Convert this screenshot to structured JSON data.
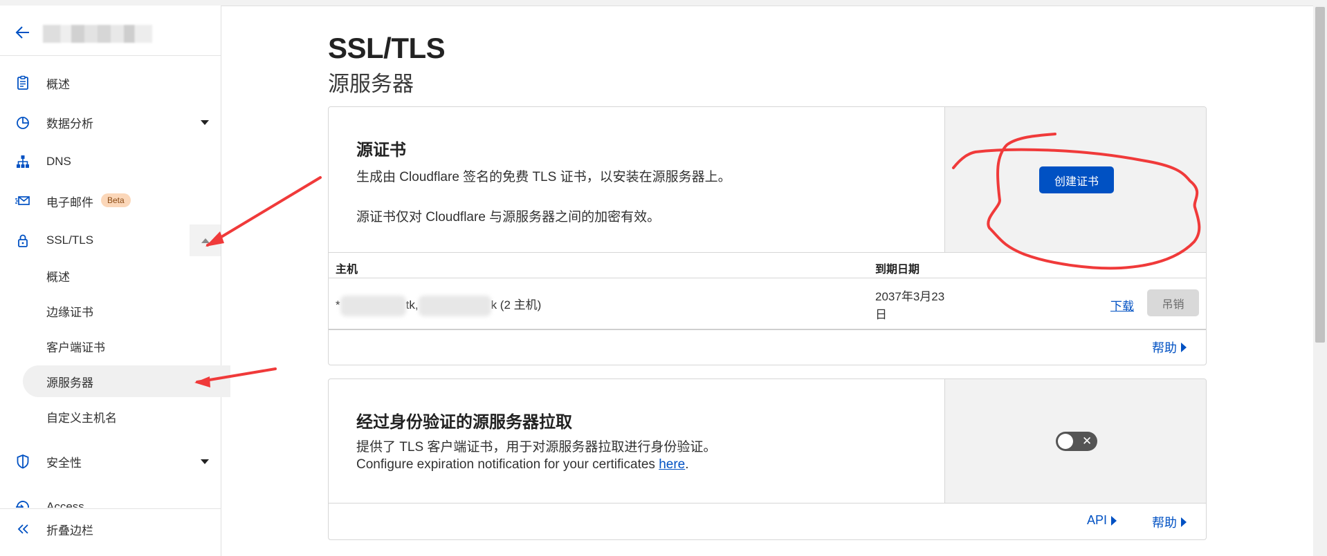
{
  "sidebar": {
    "nav": [
      {
        "label": "概述",
        "icon": "document-icon"
      },
      {
        "label": "数据分析",
        "icon": "pie-chart-icon"
      },
      {
        "label": "DNS",
        "icon": "network-tree-icon"
      },
      {
        "label": "电子邮件",
        "icon": "mail-icon",
        "badge": "Beta"
      },
      {
        "label": "SSL/TLS",
        "icon": "lock-icon"
      }
    ],
    "ssl_sub": [
      "概述",
      "边缘证书",
      "客户端证书",
      "源服务器",
      "自定义主机名"
    ],
    "security": {
      "label": "安全性",
      "icon": "shield-icon"
    },
    "access": {
      "label": "Access",
      "icon": "access-icon"
    },
    "collapse_label": "折叠边栏"
  },
  "page": {
    "title": "SSL/TLS",
    "subtitle": "源服务器"
  },
  "origin_cert": {
    "heading": "源证书",
    "desc1": "生成由 Cloudflare 签名的免费 TLS 证书，以安装在源服务器上。",
    "desc2": "源证书仅对 Cloudflare 与源服务器之间的加密有效。",
    "create_button": "创建证书",
    "col_host": "主机",
    "col_expiry": "到期日期",
    "row": {
      "host_prefix": "*",
      "host_mid": "tk,",
      "host_suffix": "k (2 主机)",
      "expiry_line1": "2037年3月23",
      "expiry_line2": "日",
      "download": "下载",
      "revoke": "吊销"
    },
    "help": "帮助"
  },
  "aop": {
    "heading": "经过身份验证的源服务器拉取",
    "desc1": "提供了 TLS 客户端证书，用于对源服务器拉取进行身份验证。",
    "desc2_prefix": "Configure expiration notification for your certificates ",
    "desc2_link": "here",
    "desc2_suffix": ".",
    "toggle_on": false,
    "api": "API",
    "help": "帮助"
  },
  "colors": {
    "accent": "#0051c3",
    "annotation": "#f03a3a",
    "beta_bg": "#fbd7b9"
  }
}
